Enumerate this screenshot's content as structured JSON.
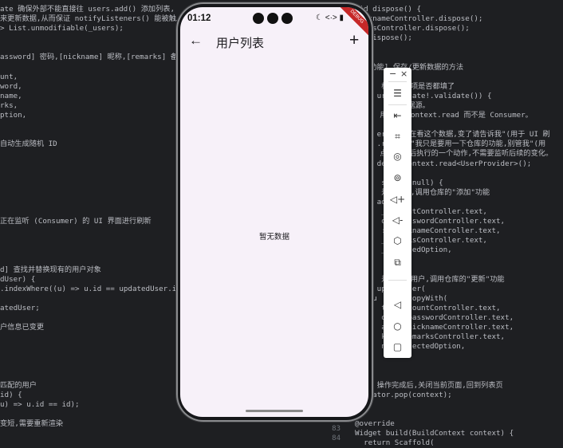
{
  "code_left": [
    "ate 确保外部不能直接往 users.add() 添加列表,",
    "来更新数据,从而保证 notifyListeners() 能被触发。",
    "> List.unmodifiable(_users);",
    "",
    "",
    "assword] 密码,[nickname] 昵称,[remarks] 备注,[o",
    "",
    "unt,",
    "word,",
    "name,",
    "rks,",
    "ption,",
    "",
    "",
    "自动生成随机 ID",
    "",
    "",
    "",
    "",
    "",
    "",
    "",
    "正在监听 (Consumer) 的 UI 界面进行刷新",
    "",
    "",
    "",
    "",
    "d] 查找并替换现有的用户对象",
    "dUser) {",
    ".indexWhere((u) => u.id == updatedUser.id);",
    "",
    "atedUser;",
    "",
    "户信息已变更",
    "",
    "",
    "",
    "",
    "",
    "匹配的用户",
    "id) {",
    "u) => u.id == id);",
    "",
    "变短,需要重新渲染"
  ],
  "code_right": [
    "oid dispose() {",
    "nicknameController.dispose();",
    "marksController.dispose();",
    "er.dispose();",
    "",
    "",
    "核心功能] 保存/更新数据的方法",
    "_sa",
    "/ 1.  检查必填项是否都填了",
    "(_f  urrentState!.validate()) {",
    "/ 2.   获取数据源。",
    "/ 注  用的是 context.read 而不是 Consumer。",
    "/ 因",
    "/ -  er 是\"我在看这个数据,变了请告诉我\"(用于 UI 刷",
    "/ -  .read 是\"我只是要用一下仓库的功能,别管我\"(用",
    "/ 因  点击按钮后执行的一个动作,不需要监听后续的变化。",
    "ina  der = context.read<UserProvider>();",
    "",
    "f (u  ser == null) {",
    " //   是新用户,调用仓库的\"添加\"功能",
    " pr  addUser(",
    "      _accountController.text,",
    "      d: _passwordController.text,",
    "      : _nicknameController.text,",
    "      _remarksController.text,",
    "      _selectedOption,",
    " );",
    " el",
    " //   是编辑旧用户,调用仓库的\"更新\"功能",
    " pr  updateUser(",
    "    u  ser!.copyWith(",
    "      t: _accountController.text,",
    "      ord: _passwordController.text,",
    "      ame: _nicknameController.text,",
    "      ks: _remarksController.text,",
    "      n: _selectedOption,",
    "",
    "",
    "",
    "/ 4. 操作完成后,关闭当前页面,回到列表页",
    "avigator.pop(context);",
    "",
    "",
    "@override",
    "Widget build(BuildContext context) {",
    "  return Scaffold("
  ],
  "gutter": [
    "82",
    "83",
    "84"
  ],
  "phone": {
    "time": "01:12",
    "status_icons": "☾ <·> ▮",
    "debug_ribbon": "DEBUG",
    "title": "用户列表",
    "back_glyph": "←",
    "add_glyph": "+",
    "empty_text": "暂无数据"
  },
  "toolbar": {
    "minimize": "−",
    "close": "×",
    "buttons": [
      "☰",
      "⇤",
      "⌗",
      "◎",
      "⊚",
      "◁+",
      "◁-",
      "⬡",
      "⧉",
      "◁",
      "○",
      "▢"
    ]
  }
}
